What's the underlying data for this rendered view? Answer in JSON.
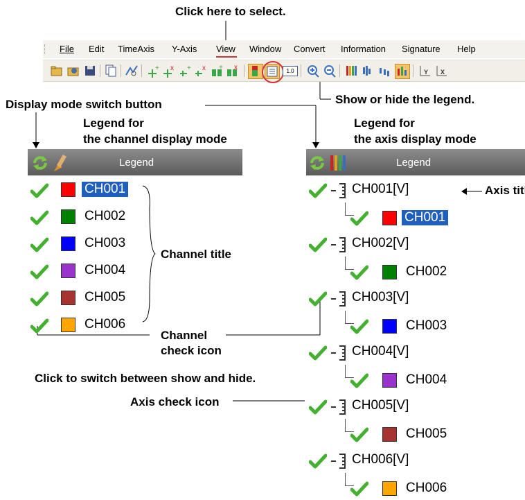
{
  "callouts": {
    "click_select": "Click here to select.",
    "show_hide_legend": "Show or hide the legend.",
    "display_mode": "Display mode switch button",
    "legend_channel": "Legend for\nthe channel display mode",
    "legend_channel_l1": "Legend for",
    "legend_channel_l2": "the channel display mode",
    "legend_axis_l1": "Legend for",
    "legend_axis_l2": "the axis display mode",
    "axis_title": "Axis title",
    "channel_title": "Channel title",
    "channel_check_l1": "Channel",
    "channel_check_l2": "check icon",
    "click_switch": "Click to switch between show and hide.",
    "axis_check": "Axis check icon"
  },
  "menu": {
    "items": [
      {
        "label": "File"
      },
      {
        "label": "Edit"
      },
      {
        "label": "TimeAxis"
      },
      {
        "label": "Y-Axis"
      },
      {
        "label": "View"
      },
      {
        "label": "Window"
      },
      {
        "label": "Convert"
      },
      {
        "label": "Information"
      },
      {
        "label": "Signature"
      },
      {
        "label": "Help"
      }
    ]
  },
  "toolbar": {
    "icons": [
      "open-folder-icon",
      "find-icon",
      "save-icon",
      "copy-icon",
      "zoom-tool-icon",
      "add-cursor-icon",
      "delete-cursor-icon",
      "add-marker-icon",
      "delete-marker-icon",
      "add-region-icon",
      "delete-region-icon",
      "color-icon",
      "legend-icon",
      "scale-value-icon",
      "zoom-in-icon",
      "zoom-out-icon",
      "bars-icon",
      "bars-alt-icon",
      "bars-small-icon",
      "bars-toggle-icon",
      "y-axis-icon",
      "x-axis-icon"
    ],
    "scale_label": "1.0"
  },
  "legend_channel": {
    "title": "Legend",
    "channels": [
      {
        "name": "CH001",
        "color": "#ff0000",
        "selected": true
      },
      {
        "name": "CH002",
        "color": "#008000",
        "selected": false
      },
      {
        "name": "CH003",
        "color": "#0000ff",
        "selected": false
      },
      {
        "name": "CH004",
        "color": "#9933cc",
        "selected": false
      },
      {
        "name": "CH005",
        "color": "#a83232",
        "selected": false
      },
      {
        "name": "CH006",
        "color": "#ffa500",
        "selected": false
      }
    ]
  },
  "legend_axis": {
    "title": "Legend",
    "axes": [
      {
        "axis": "CH001[V]",
        "channel": "CH001",
        "color": "#ff0000",
        "selected": true
      },
      {
        "axis": "CH002[V]",
        "channel": "CH002",
        "color": "#008000",
        "selected": false
      },
      {
        "axis": "CH003[V]",
        "channel": "CH003",
        "color": "#0000ff",
        "selected": false
      },
      {
        "axis": "CH004[V]",
        "channel": "CH004",
        "color": "#9933cc",
        "selected": false
      },
      {
        "axis": "CH005[V]",
        "channel": "CH005",
        "color": "#a83232",
        "selected": false
      },
      {
        "axis": "CH006[V]",
        "channel": "CH006",
        "color": "#ffa500",
        "selected": false
      }
    ]
  },
  "colors": {
    "check_green": "#44b030",
    "selection_blue": "#1f5fbf",
    "callout_red": "#d93030"
  }
}
